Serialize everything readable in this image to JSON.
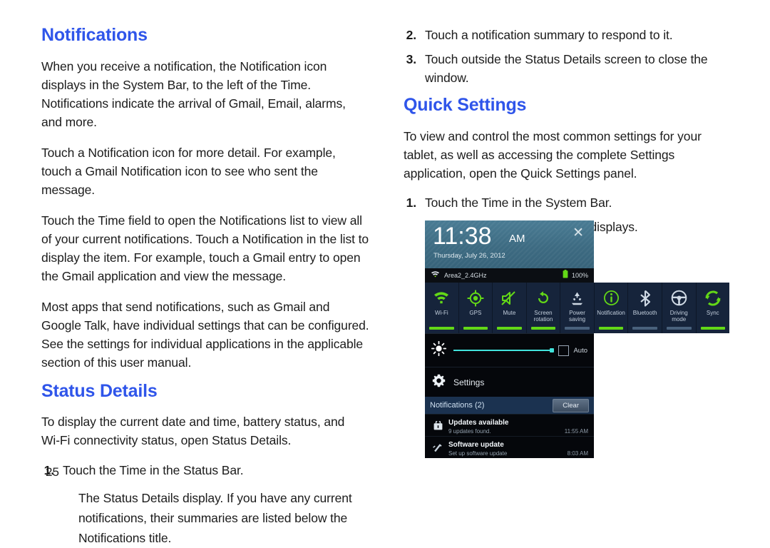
{
  "page": {
    "number": "25"
  },
  "left_column": {
    "heading_notifications": "Notifications",
    "p1": "When you receive a notification, the Notification icon displays in the System Bar, to the left of the Time. Notifications indicate the arrival of Gmail, Email, alarms, and more.",
    "p2": "Touch a Notification icon for more detail. For example, touch a Gmail Notification icon to see who sent the message.",
    "p3": "Touch the Time field to open the Notifications list to view all of your current notifications. Touch a Notification in the list to display the item. For example, touch a Gmail entry to open the Gmail application and view the message.",
    "p4": "Most apps that send notifications, such as Gmail and Google Talk, have individual settings that can be configured. See the settings for individual applications in the applicable section of this user manual.",
    "heading_status_details": "Status Details",
    "p5": "To display the current date and time, battery status, and Wi-Fi connectivity status, open Status Details.",
    "step1_num": "1.",
    "step1_text": "Touch the Time in the Status Bar.",
    "step1_sub": "The Status Details display. If you have any current notifications, their summaries are listed below the Notifications title."
  },
  "right_column": {
    "step2_num": "2.",
    "step2_text": "Touch a notification summary to respond to it.",
    "step3_num": "3.",
    "step3_text": "Touch outside the Status Details screen to close the window.",
    "heading_quick_settings": "Quick Settings",
    "p1": "To view and control the most common settings for your tablet, as well as accessing the complete Settings application, open the Quick Settings panel.",
    "step1_num": "1.",
    "step1_text": "Touch the Time in the System Bar.",
    "step1_sub": "The Quick Settings pop-up displays."
  },
  "screenshot": {
    "header": {
      "time": "11:38",
      "ampm": "AM",
      "date": "Thursday, July 26, 2012",
      "close_icon": "close-icon"
    },
    "status_bar": {
      "wifi_icon": "wifi-icon",
      "ssid": "Area2_2.4GHz",
      "battery_icon": "battery-icon",
      "battery_level": "100%"
    },
    "tiles": [
      {
        "label": "Wi-Fi",
        "icon": "wifi-icon",
        "state": "on"
      },
      {
        "label": "GPS",
        "icon": "gps-icon",
        "state": "on"
      },
      {
        "label": "Mute",
        "icon": "mute-icon",
        "state": "on"
      },
      {
        "label": "Screen\nrotation",
        "label_line1": "Screen",
        "label_line2": "rotation",
        "icon": "screen-rotation-icon",
        "state": "on"
      },
      {
        "label": "Power\nsaving",
        "label_line1": "Power",
        "label_line2": "saving",
        "icon": "power-saving-icon",
        "state": "off"
      },
      {
        "label": "Notification",
        "label_line1": "Notification",
        "label_line2": "",
        "icon": "notification-icon",
        "state": "on"
      },
      {
        "label": "Bluetooth",
        "label_line1": "Bluetooth",
        "label_line2": "",
        "icon": "bluetooth-icon",
        "state": "off"
      },
      {
        "label": "Driving\nmode",
        "label_line1": "Driving",
        "label_line2": "mode",
        "icon": "driving-mode-icon",
        "state": "off"
      },
      {
        "label": "Sync",
        "label_line1": "Sync",
        "label_line2": "",
        "icon": "sync-icon",
        "state": "on"
      }
    ],
    "brightness": {
      "icon": "brightness-icon",
      "auto_label": "Auto",
      "auto_checked": false,
      "value_percent": 100
    },
    "settings_row": {
      "icon": "gear-icon",
      "label": "Settings"
    },
    "notifications": {
      "title": "Notifications (2)",
      "clear_label": "Clear",
      "items": [
        {
          "icon": "updates-icon",
          "title": "Updates available",
          "subtitle": "9 updates found.",
          "time": "11:55 AM"
        },
        {
          "icon": "software-update-icon",
          "title": "Software update",
          "subtitle": "Set up software update",
          "time": "8:03 AM"
        }
      ]
    },
    "colors": {
      "accent_green": "#63d817",
      "tile_bg": "#16243b",
      "header_blue": "#3d6b82",
      "slider_cyan": "#41e3dc",
      "heading_blue": "#2f55ea"
    }
  }
}
